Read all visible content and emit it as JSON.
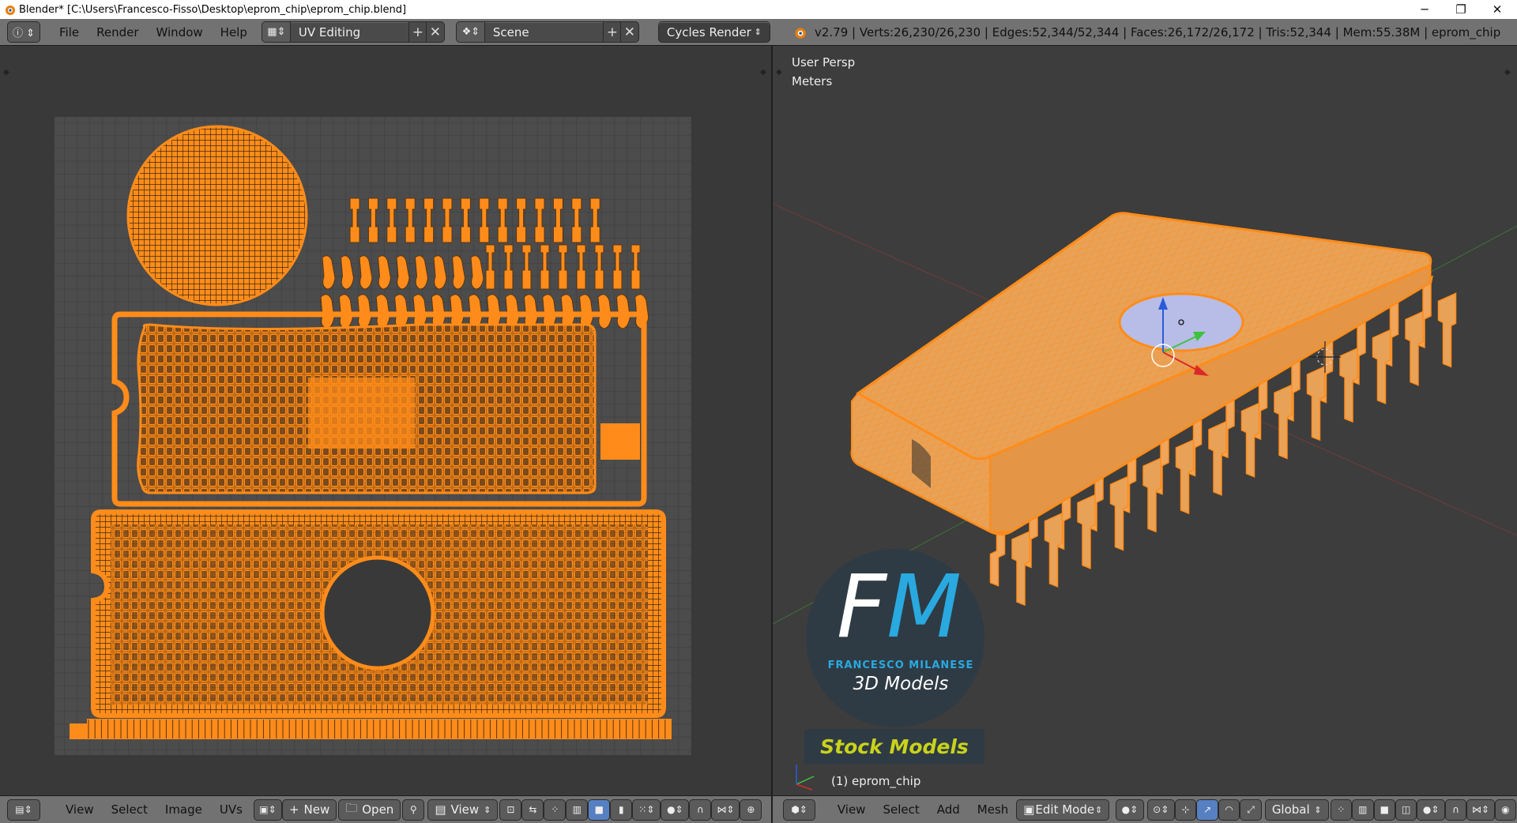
{
  "window": {
    "title": "Blender* [C:\\Users\\Francesco-Fisso\\Desktop\\eprom_chip\\eprom_chip.blend]",
    "minimize_label": "─",
    "restore_label": "❐",
    "close_label": "✕"
  },
  "infobar": {
    "menus": [
      "File",
      "Render",
      "Window",
      "Help"
    ],
    "screen_layout": "UV Editing",
    "scene": "Scene",
    "render_engine": "Cycles Render",
    "stats": "v2.79 | Verts:26,230/26,230 | Edges:52,344/52,344 | Faces:26,172/26,172 | Tris:52,344 | Mem:55.38M | eprom_chip"
  },
  "viewport": {
    "view_name": "User Persp",
    "units": "Meters",
    "object_label": "(1) eprom_chip",
    "watermark": {
      "monogram_f": "F",
      "monogram_m": "M",
      "name": "FRANCESCO MILANESE",
      "tagline": "3D Models",
      "banner": "Stock Models"
    }
  },
  "uv_header": {
    "menus": [
      "View",
      "Select",
      "Image",
      "UVs"
    ],
    "new_label": "New",
    "open_label": "Open",
    "view_label": "View"
  },
  "vp_header": {
    "menus": [
      "View",
      "Select",
      "Add",
      "Mesh"
    ],
    "mode": "Edit Mode",
    "orientation": "Global"
  },
  "colors": {
    "uv_orange": "#ff8c1a",
    "uv_grid_bg": "#4c4c4c",
    "accent_blue": "#5680c2",
    "header_gray": "#727272"
  }
}
